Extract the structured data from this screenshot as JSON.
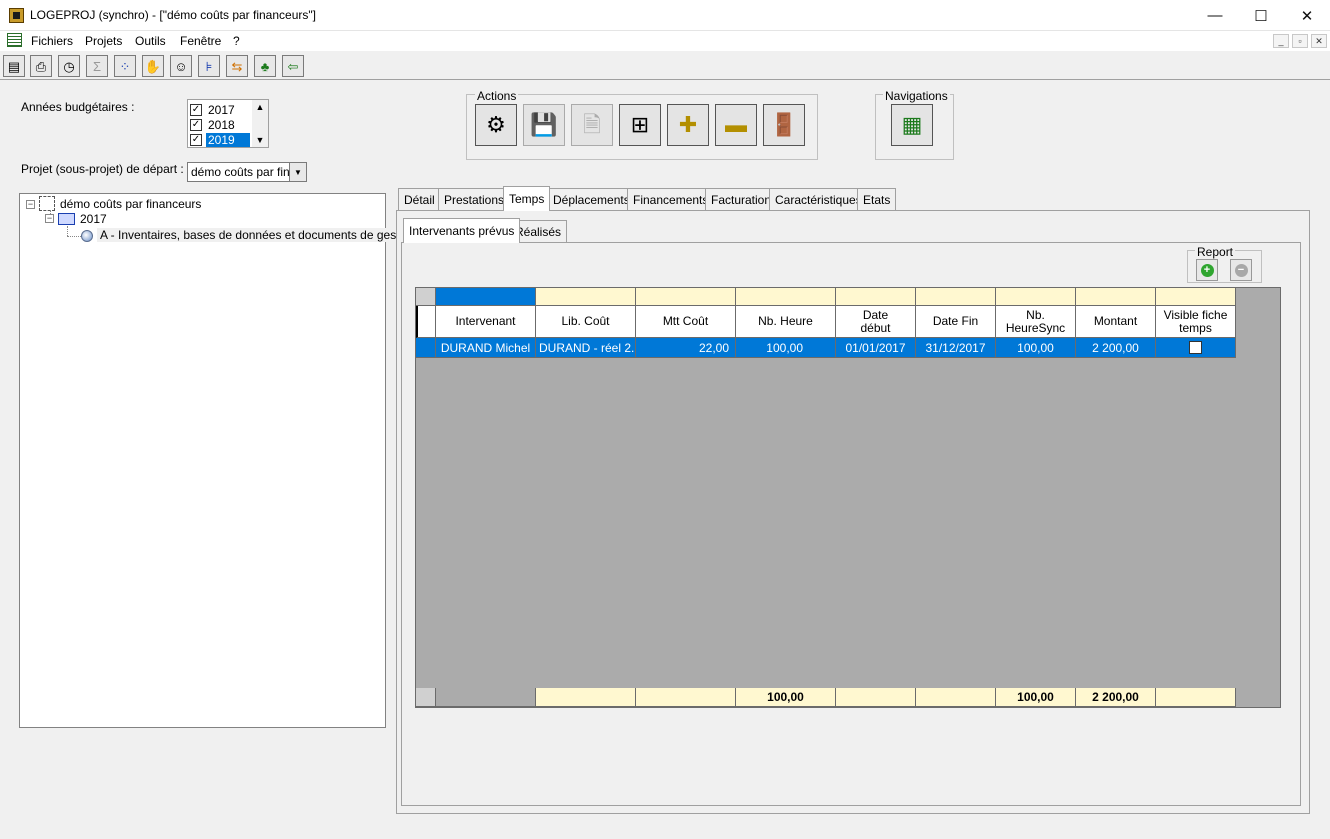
{
  "window": {
    "title": "LOGEPROJ (synchro) - [\"démo coûts par financeurs\"]",
    "minimize": "—",
    "maximize": "☐",
    "close": "✕"
  },
  "menu": {
    "items": [
      "Fichiers",
      "Projets",
      "Outils",
      "Fenêtre",
      "?"
    ],
    "mdi": [
      "_",
      "▫",
      "✕"
    ]
  },
  "toolbar": {
    "icons": [
      "table-icon",
      "printer-icon",
      "clock-icon",
      "sum-icon",
      "network-icon",
      "handshake-icon",
      "person-icon",
      "hierarchy-icon",
      "arrows-icon",
      "money-bag-icon",
      "exit-door-icon"
    ],
    "glyphs": [
      "▤",
      "⎙",
      "◷",
      "Σ",
      "⁘",
      "✋",
      "☺",
      "⊧",
      "⇆",
      "♣",
      "⇦"
    ]
  },
  "left": {
    "years_label": "Années budgétaires :",
    "years": [
      {
        "label": "2017",
        "checked": true
      },
      {
        "label": "2018",
        "checked": true
      },
      {
        "label": "2019",
        "checked": true,
        "selected": true
      }
    ],
    "project_label": "Projet (sous-projet) de départ :",
    "project_value": "démo coûts par finan",
    "tree": {
      "root": "démo coûts par financeurs",
      "year": "2017",
      "leaf": "A - Inventaires, bases de données et documents de gestion"
    }
  },
  "actions": {
    "title": "Actions",
    "buttons": [
      "⚙",
      "💾",
      "🗎",
      "⊞",
      "✚",
      "▬",
      "🚪"
    ]
  },
  "navigations": {
    "title": "Navigations",
    "button": "▦"
  },
  "tabs": [
    "Détail",
    "Prestations",
    "Temps",
    "Déplacements",
    "Financements",
    "Facturation",
    "Caractéristiques",
    "Etats"
  ],
  "subtabs": [
    "Intervenants prévus",
    "Réalisés"
  ],
  "report": {
    "title": "Report",
    "add": "+",
    "remove": "−"
  },
  "grid": {
    "headers": [
      "Intervenant",
      "Lib. Coût",
      "Mtt Coût",
      "Nb. Heure",
      "Date début",
      "Date Fin",
      "Nb. HeureSync",
      "Montant",
      "Visible fiche temps"
    ],
    "rows": [
      [
        "DURAND Michel",
        "DURAND - réel 2...",
        "22,00",
        "100,00",
        "01/01/2017",
        "31/12/2017",
        "100,00",
        "2 200,00",
        ""
      ]
    ],
    "totals": [
      "",
      "",
      "",
      "100,00",
      "",
      "",
      "100,00",
      "2 200,00",
      ""
    ]
  }
}
